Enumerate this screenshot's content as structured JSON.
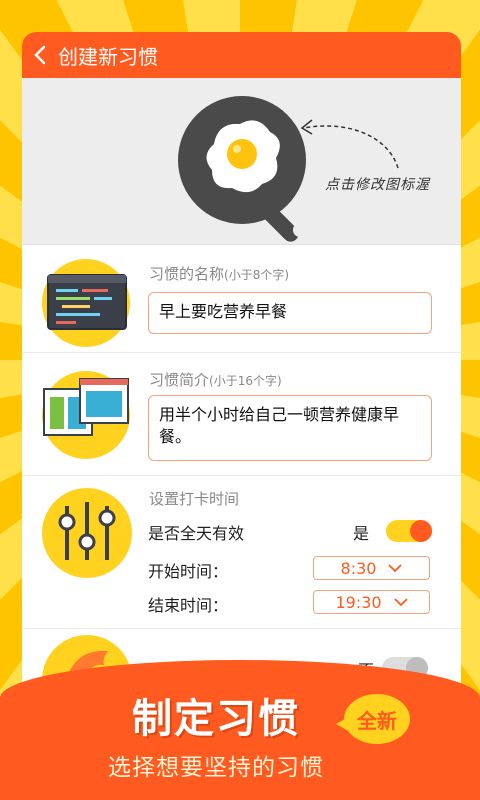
{
  "header": {
    "title": "创建新习惯"
  },
  "hero": {
    "hint": "点击修改图标渥"
  },
  "name_row": {
    "label": "习惯的名称",
    "hint": "(小于8个字)",
    "value": "早上要吃营养早餐"
  },
  "intro_row": {
    "label": "习惯简介",
    "hint": "(小于16个字)",
    "value": "用半个小时给自己一顿营养健康早餐。"
  },
  "time_row": {
    "label": "设置打卡时间",
    "allday_label": "是否全天有效",
    "allday_value": "是",
    "start_label": "开始时间：",
    "start_value": "8:30",
    "end_label": "结束时间：",
    "end_value": "19:30"
  },
  "next_row": {
    "toggle_value": "否"
  },
  "banner": {
    "slogan": "制定习惯",
    "subslogan": "选择想要坚持的习惯",
    "badge": "全新"
  },
  "colors": {
    "accent": "#FF5A1F",
    "background": "#FFD21F",
    "toggle_on": "#FFD21F"
  }
}
